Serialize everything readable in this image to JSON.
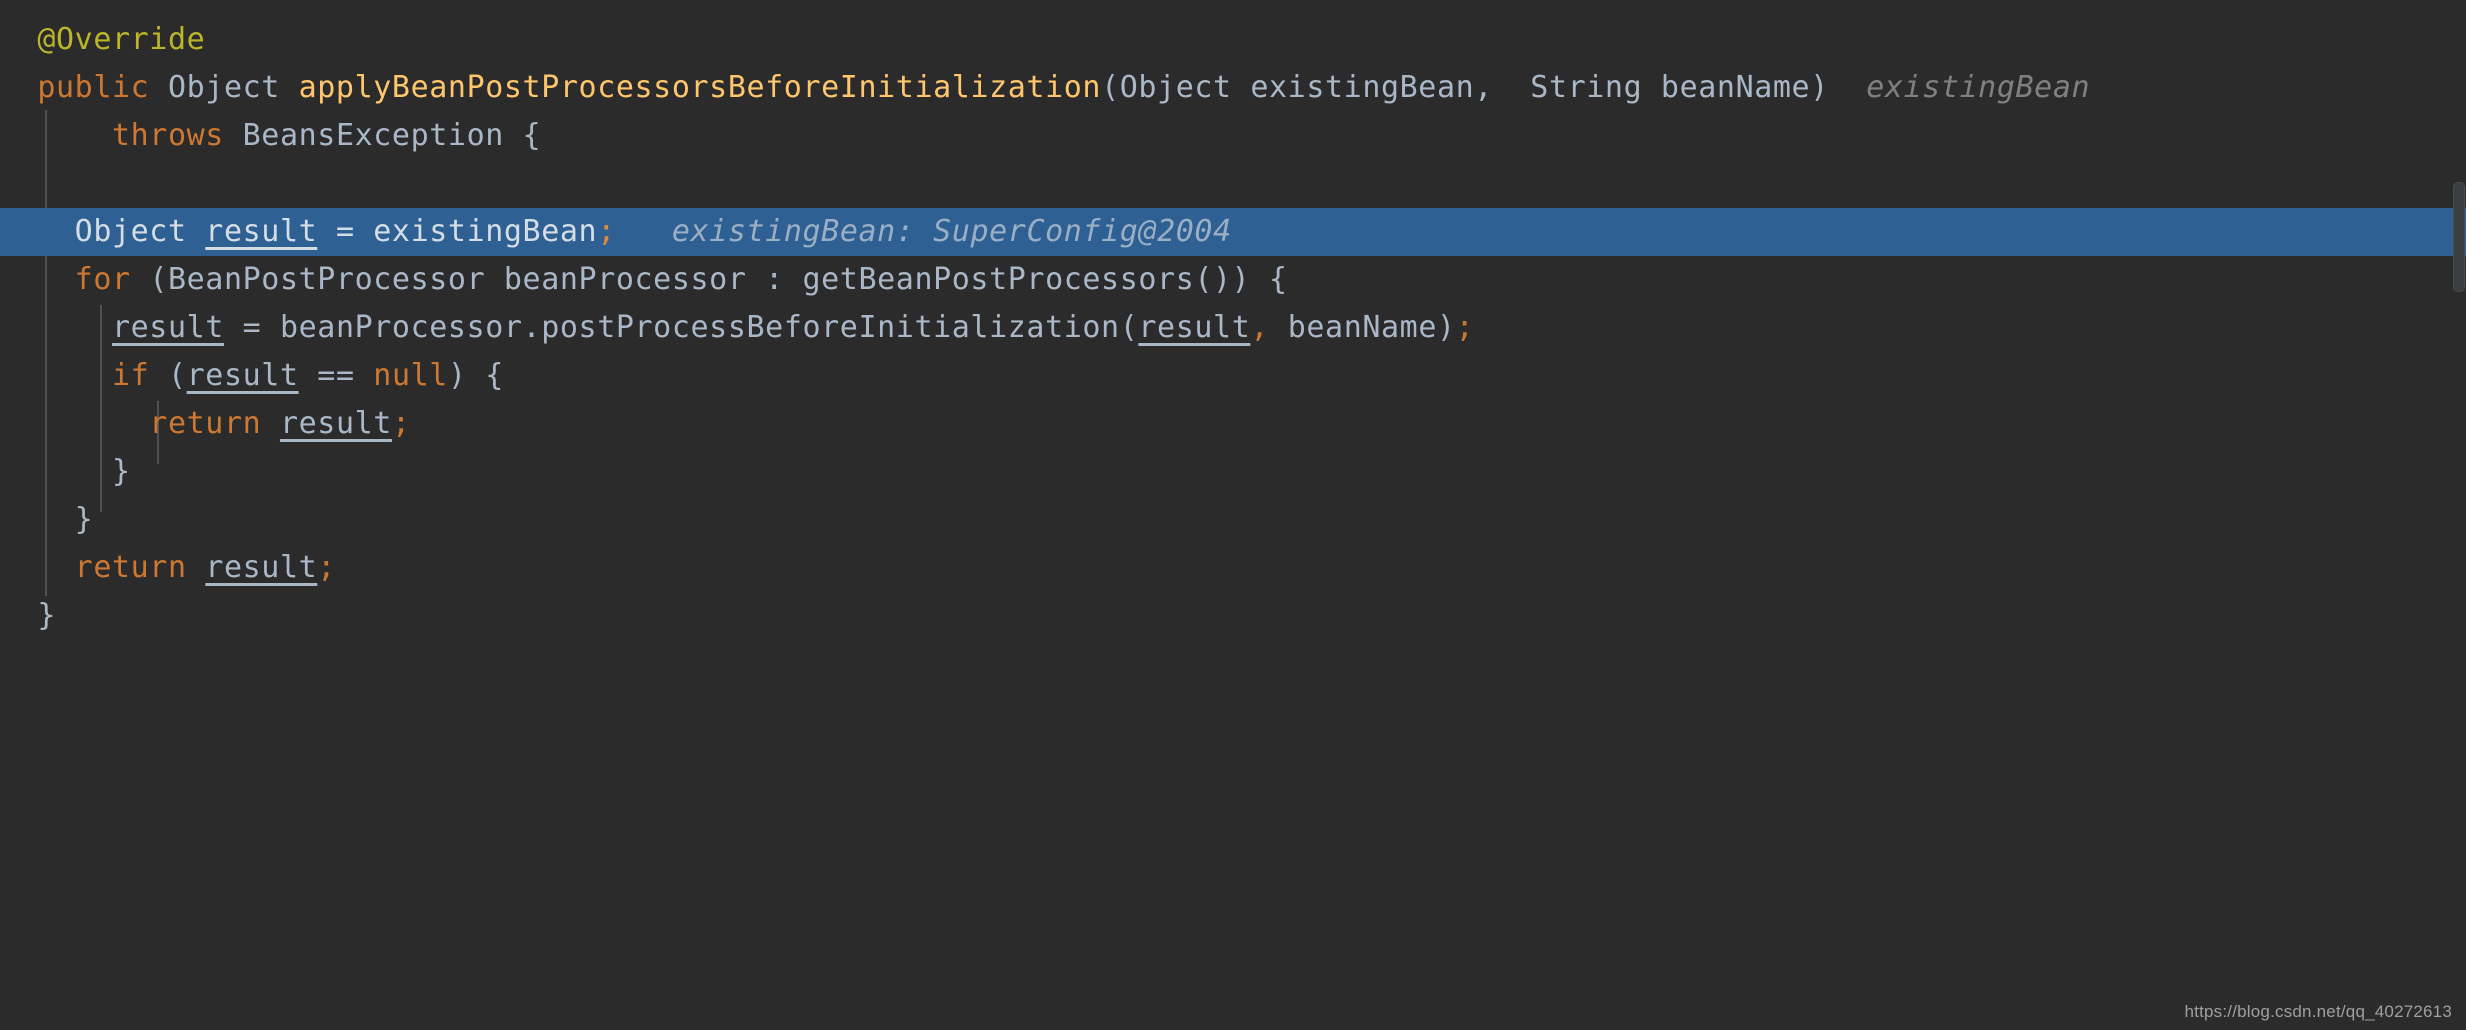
{
  "editor": {
    "theme_name": "darcula",
    "background_color": "#2b2b2b",
    "current_line_color": "#2e6094",
    "default_text_color": "#a9b7c6",
    "keyword_color": "#cc7832",
    "method_color": "#ffc66d",
    "annotation_color": "#bbb529",
    "hint_color": "#808080",
    "language": "java"
  },
  "code": {
    "line1": {
      "annotation": "@Override"
    },
    "line2": {
      "kw_public": "public",
      "type_object": " Object ",
      "method_name": "applyBeanPostProcessorsBeforeInitialization",
      "params": "(Object existingBean, ",
      "comma": ",",
      "params2": " String beanName)",
      "trailing_hint": "existingBean"
    },
    "line3": {
      "kw_throws": "throws",
      "rest": " BeansException {"
    },
    "line4": {
      "type": "Object ",
      "local_var": "result",
      "assign": " = existingBean",
      "semi": ";",
      "inline_hint": "existingBean: SuperConfig@2004"
    },
    "line5": {
      "kw_for": "for",
      "rest": " (BeanPostProcessor beanProcessor : getBeanPostProcessors()) {"
    },
    "line6": {
      "local_var": "result",
      "mid": " = beanProcessor.postProcessBeforeInitialization(",
      "arg_var": "result",
      "comma": ",",
      "rest": " beanName)",
      "semi": ";"
    },
    "line7": {
      "kw_if": "if",
      "paren_open": " (",
      "local_var": "result",
      "op": " == ",
      "kw_null": "null",
      "rest": ") {"
    },
    "line8": {
      "kw_return": "return",
      "space": " ",
      "local_var": "result",
      "semi": ";"
    },
    "line9": {
      "brace": "}"
    },
    "line10": {
      "brace": "}"
    },
    "line11": {
      "kw_return": "return",
      "space": " ",
      "local_var": "result",
      "semi": ";"
    },
    "line12": {
      "brace": "}"
    }
  },
  "scrollbar": {
    "orientation": "vertical"
  },
  "watermark": {
    "text": "https://blog.csdn.net/qq_40272613"
  }
}
